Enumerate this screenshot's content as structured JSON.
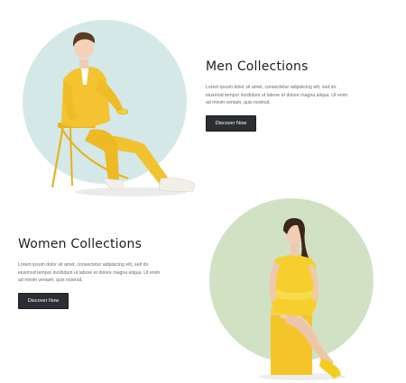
{
  "men": {
    "title": "Men Collections",
    "body": "Lorem ipsum dolor sit amet, consectetur adipisicing elit, sed do eiusmod tempor incididunt ut labore et dolore magna aliqua. Ut enim ad minim veniam, quis nostrud.",
    "button_label": "Discover Now",
    "circle_color": "#d4e8e8"
  },
  "women": {
    "title": "Women Collections",
    "body": "Lorem ipsum dolor sit amet, consectetur adipisicing elit, sed do eiusmod tempor incididunt ut labore et dolore magna aliqua. Ut enim ad minim veniam, quis nostrud.",
    "button_label": "Discover Now",
    "circle_color": "#d1e2c4"
  },
  "colors": {
    "button_bg": "#2b2f33",
    "outfit_yellow": "#f2c230"
  }
}
